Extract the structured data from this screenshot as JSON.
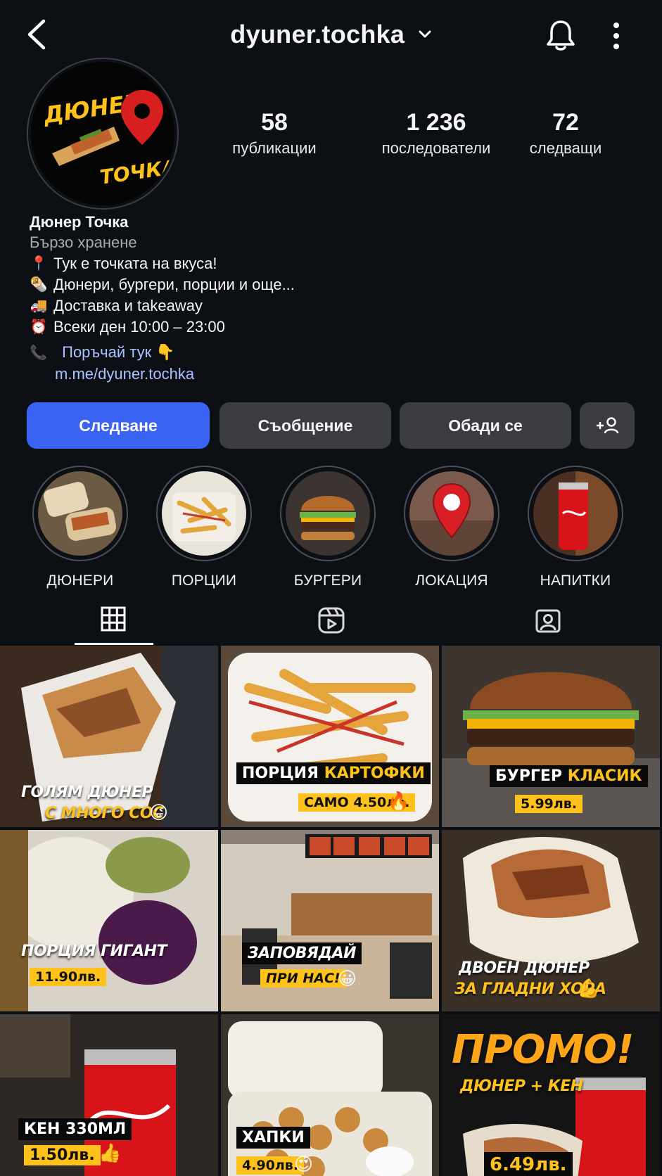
{
  "header": {
    "username": "dyuner.tochka"
  },
  "profile": {
    "avatar_text_top": "ДЮНЕР",
    "avatar_text_bottom": "ТОЧКА",
    "stats": {
      "posts": {
        "value": "58",
        "label": "публикации"
      },
      "followers": {
        "value": "1 236",
        "label": "последователи"
      },
      "following": {
        "value": "72",
        "label": "следващи"
      }
    },
    "bio": {
      "name": "Дюнер Точка",
      "category": "Бързо хранене",
      "lines": [
        {
          "emoji": "📍",
          "text": "Тук е точката на вкуса!"
        },
        {
          "emoji": "🌯",
          "text": "Дюнери, бургери, порции и още..."
        },
        {
          "emoji": "🚚",
          "text": "Доставка и takeaway"
        },
        {
          "emoji": "⏰",
          "text": "Всеки ден 10:00 – 23:00"
        }
      ],
      "cta_emoji": "📞",
      "cta_text": "Поръчай тук 👇",
      "link": "m.me/dyuner.tochka"
    }
  },
  "buttons": {
    "follow": "Следване",
    "message": "Съобщение",
    "call": "Обади се",
    "add_user": "+👤"
  },
  "highlights": [
    {
      "label": "ДЮНЕРИ"
    },
    {
      "label": "ПОРЦИИ"
    },
    {
      "label": "БУРГЕРИ"
    },
    {
      "label": "ЛОКАЦИЯ"
    },
    {
      "label": "НАПИТКИ"
    }
  ],
  "tabs": [
    "grid-icon",
    "reels-icon",
    "tagged-icon"
  ],
  "posts": [
    {
      "line1": "ГОЛЯМ ДЮНЕР",
      "line2": "С МНОГО СОС",
      "emoji": "😜"
    },
    {
      "line1_a": "ПОРЦИЯ",
      "line1_b": "КАРТОФКИ",
      "line2": "САМО 4.50лв.",
      "emoji": "🔥"
    },
    {
      "line1_a": "БУРГЕР",
      "line1_b": "КЛАСИК",
      "price": "5.99лв."
    },
    {
      "line1": "ПОРЦИЯ ГИГАНТ",
      "price": "11.90лв."
    },
    {
      "line1": "ЗАПОВЯДАЙ",
      "line2": "ПРИ НАС!",
      "emoji": "😀"
    },
    {
      "line1": "ДВОЕН ДЮНЕР",
      "line2": "ЗА ГЛАДНИ ХОРА",
      "emoji": "💪"
    },
    {
      "line1": "КЕН 330МЛ",
      "price": "1.50лв.",
      "emoji": "👍",
      "brand": "Coca-Cola"
    },
    {
      "line1": "ХАПКИ",
      "price": "4.90лв.",
      "emoji": "😍"
    },
    {
      "title": "ПРОМО!",
      "subtitle": "ДЮНЕР + КЕН",
      "price": "6.49лв.",
      "brand": "Coca-Cola"
    }
  ],
  "colors": {
    "background": "#0c0f14",
    "accent_blue": "#3b63f4",
    "button_gray": "#3a3c42",
    "link_blue": "#a9c2ff",
    "promo_yellow": "#ffc21a"
  }
}
